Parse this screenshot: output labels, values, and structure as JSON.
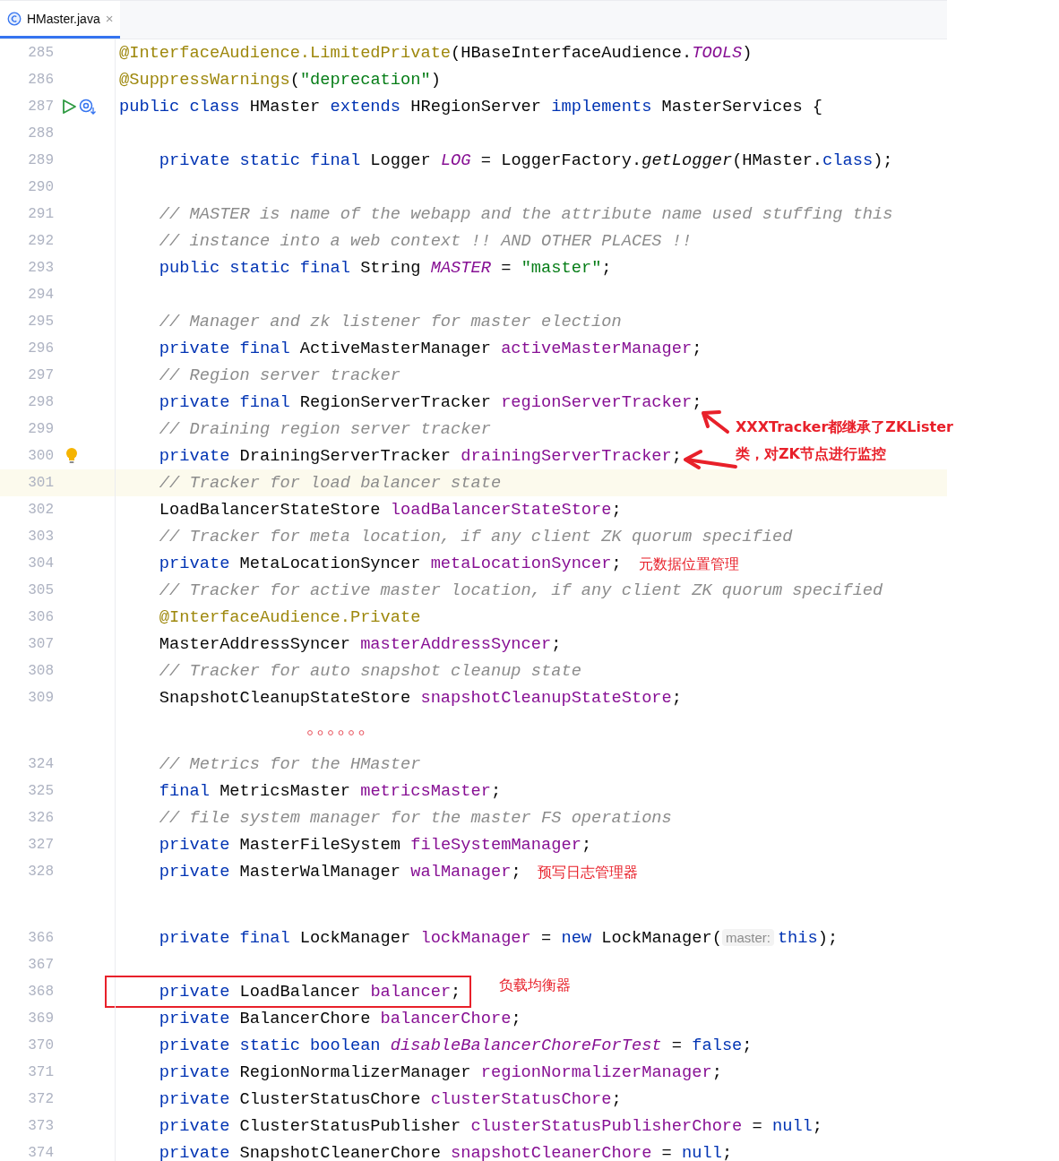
{
  "tabs": [
    {
      "label": "HMaster.java",
      "selected": true,
      "close": "×"
    }
  ],
  "blocks": [
    {
      "lines": [
        {
          "num": "285",
          "tokens": [
            {
              "t": "@InterfaceAudience.LimitedPrivate",
              "kind": "ann"
            },
            {
              "t": "(HBaseInterfaceAudience.",
              "kind": "plain"
            },
            {
              "t": "TOOLS",
              "kind": "sfield"
            },
            {
              "t": ")",
              "kind": "plain"
            }
          ]
        },
        {
          "num": "286",
          "tokens": [
            {
              "t": "@SuppressWarnings",
              "kind": "ann"
            },
            {
              "t": "(",
              "kind": "plain"
            },
            {
              "t": "\"deprecation\"",
              "kind": "string"
            },
            {
              "t": ")",
              "kind": "plain"
            }
          ]
        },
        {
          "num": "287",
          "runnable": true,
          "tokens": [
            {
              "t": "public class ",
              "kind": "kw"
            },
            {
              "t": "HMaster ",
              "kind": "plain"
            },
            {
              "t": "extends ",
              "kind": "kw"
            },
            {
              "t": "HRegionServer ",
              "kind": "plain"
            },
            {
              "t": "implements ",
              "kind": "kw"
            },
            {
              "t": "MasterServices {",
              "kind": "plain"
            }
          ]
        },
        {
          "num": "288"
        },
        {
          "num": "289",
          "tokens": [
            {
              "t": "    private static final ",
              "kind": "kw"
            },
            {
              "t": "Logger ",
              "kind": "plain"
            },
            {
              "t": "LOG",
              "kind": "sfield"
            },
            {
              "t": " = LoggerFactory.",
              "kind": "plain"
            },
            {
              "t": "getLogger",
              "kind": "smethod"
            },
            {
              "t": "(HMaster.",
              "kind": "plain"
            },
            {
              "t": "class",
              "kind": "kw"
            },
            {
              "t": ");",
              "kind": "plain"
            }
          ]
        },
        {
          "num": "290"
        },
        {
          "num": "291",
          "tokens": [
            {
              "t": "    // MASTER is name of the webapp and the attribute name used stuffing this",
              "kind": "comment"
            }
          ]
        },
        {
          "num": "292",
          "tokens": [
            {
              "t": "    // instance into a web context !! AND OTHER PLACES !!",
              "kind": "comment"
            }
          ]
        },
        {
          "num": "293",
          "tokens": [
            {
              "t": "    public static final ",
              "kind": "kw"
            },
            {
              "t": "String ",
              "kind": "plain"
            },
            {
              "t": "MASTER",
              "kind": "sfield"
            },
            {
              "t": " = ",
              "kind": "plain"
            },
            {
              "t": "\"master\"",
              "kind": "string"
            },
            {
              "t": ";",
              "kind": "plain"
            }
          ]
        },
        {
          "num": "294"
        },
        {
          "num": "295",
          "tokens": [
            {
              "t": "    // Manager and zk listener for master election",
              "kind": "comment"
            }
          ]
        },
        {
          "num": "296",
          "tokens": [
            {
              "t": "    private final ",
              "kind": "kw"
            },
            {
              "t": "ActiveMasterManager ",
              "kind": "plain"
            },
            {
              "t": "activeMasterManager",
              "kind": "field"
            },
            {
              "t": ";",
              "kind": "plain"
            }
          ]
        },
        {
          "num": "297",
          "tokens": [
            {
              "t": "    // Region server tracker",
              "kind": "comment"
            }
          ]
        },
        {
          "num": "298",
          "tokens": [
            {
              "t": "    private final ",
              "kind": "kw"
            },
            {
              "t": "RegionServerTracker ",
              "kind": "plain"
            },
            {
              "t": "regionServerTracker",
              "kind": "field"
            },
            {
              "t": ";",
              "kind": "plain"
            }
          ]
        },
        {
          "num": "299",
          "tokens": [
            {
              "t": "    // Draining region server tracker",
              "kind": "comment"
            }
          ]
        },
        {
          "num": "300",
          "intention": true,
          "tokens": [
            {
              "t": "    private ",
              "kind": "kw"
            },
            {
              "t": "DrainingServerTracker ",
              "kind": "plain"
            },
            {
              "t": "drainingServerTracker",
              "kind": "field"
            },
            {
              "t": ";",
              "kind": "plain"
            }
          ]
        },
        {
          "num": "301",
          "current": true,
          "tokens": [
            {
              "t": "    // Tracker for load balancer state",
              "kind": "comment"
            }
          ]
        },
        {
          "num": "302",
          "tokens": [
            {
              "t": "    LoadBalancerStateStore ",
              "kind": "plain"
            },
            {
              "t": "loadBalancerStateStore",
              "kind": "field"
            },
            {
              "t": ";",
              "kind": "plain"
            }
          ]
        },
        {
          "num": "303",
          "tokens": [
            {
              "t": "    // Tracker for meta location, if any client ZK quorum specified",
              "kind": "comment"
            }
          ]
        },
        {
          "num": "304",
          "tokens": [
            {
              "t": "    private ",
              "kind": "kw"
            },
            {
              "t": "MetaLocationSyncer ",
              "kind": "plain"
            },
            {
              "t": "metaLocationSyncer",
              "kind": "field"
            },
            {
              "t": ";",
              "kind": "plain"
            }
          ]
        },
        {
          "num": "305",
          "tokens": [
            {
              "t": "    // Tracker for active master location, if any client ZK quorum specified",
              "kind": "comment"
            }
          ]
        },
        {
          "num": "306",
          "tokens": [
            {
              "t": "    @InterfaceAudience.Private",
              "kind": "ann"
            }
          ]
        },
        {
          "num": "307",
          "tokens": [
            {
              "t": "    MasterAddressSyncer ",
              "kind": "plain"
            },
            {
              "t": "masterAddressSyncer",
              "kind": "field"
            },
            {
              "t": ";",
              "kind": "plain"
            }
          ]
        },
        {
          "num": "308",
          "tokens": [
            {
              "t": "    // Tracker for auto snapshot cleanup state",
              "kind": "comment"
            }
          ]
        },
        {
          "num": "309",
          "tokens": [
            {
              "t": "    SnapshotCleanupStateStore ",
              "kind": "plain"
            },
            {
              "t": "snapshotCleanupStateStore",
              "kind": "field"
            },
            {
              "t": ";",
              "kind": "plain"
            }
          ]
        }
      ]
    },
    {
      "lines": [
        {
          "num": "324",
          "tokens": [
            {
              "t": "    // Metrics for the HMaster",
              "kind": "comment"
            }
          ]
        },
        {
          "num": "325",
          "tokens": [
            {
              "t": "    final ",
              "kind": "kw"
            },
            {
              "t": "MetricsMaster ",
              "kind": "plain"
            },
            {
              "t": "metricsMaster",
              "kind": "field"
            },
            {
              "t": ";",
              "kind": "plain"
            }
          ]
        },
        {
          "num": "326",
          "tokens": [
            {
              "t": "    // file system manager for the master FS operations",
              "kind": "comment"
            }
          ]
        },
        {
          "num": "327",
          "tokens": [
            {
              "t": "    private ",
              "kind": "kw"
            },
            {
              "t": "MasterFileSystem ",
              "kind": "plain"
            },
            {
              "t": "fileSystemManager",
              "kind": "field"
            },
            {
              "t": ";",
              "kind": "plain"
            }
          ]
        },
        {
          "num": "328",
          "tokens": [
            {
              "t": "    private ",
              "kind": "kw"
            },
            {
              "t": "MasterWalManager ",
              "kind": "plain"
            },
            {
              "t": "walManager",
              "kind": "field"
            },
            {
              "t": ";",
              "kind": "plain"
            }
          ]
        }
      ]
    },
    {
      "lines": [
        {
          "num": "366",
          "tokens": [
            {
              "t": "    private final ",
              "kind": "kw"
            },
            {
              "t": "LockManager ",
              "kind": "plain"
            },
            {
              "t": "lockManager",
              "kind": "field"
            },
            {
              "t": " = ",
              "kind": "plain"
            },
            {
              "t": "new ",
              "kind": "kw"
            },
            {
              "t": "LockManager(",
              "kind": "plain"
            },
            {
              "t": "master:",
              "kind": "hint"
            },
            {
              "t": "this",
              "kind": "kw"
            },
            {
              "t": ");",
              "kind": "plain"
            }
          ]
        },
        {
          "num": "367"
        },
        {
          "num": "368",
          "boxed": true,
          "tokens": [
            {
              "t": "    private ",
              "kind": "kw"
            },
            {
              "t": "LoadBalancer ",
              "kind": "plain"
            },
            {
              "t": "balancer",
              "kind": "field"
            },
            {
              "t": ";",
              "kind": "plain"
            }
          ]
        },
        {
          "num": "369",
          "tokens": [
            {
              "t": "    private ",
              "kind": "kw"
            },
            {
              "t": "BalancerChore ",
              "kind": "plain"
            },
            {
              "t": "balancerChore",
              "kind": "field"
            },
            {
              "t": ";",
              "kind": "plain"
            }
          ]
        },
        {
          "num": "370",
          "tokens": [
            {
              "t": "    private static boolean ",
              "kind": "kw"
            },
            {
              "t": "disableBalancerChoreForTest",
              "kind": "sfield"
            },
            {
              "t": " = ",
              "kind": "plain"
            },
            {
              "t": "false",
              "kind": "kw"
            },
            {
              "t": ";",
              "kind": "plain"
            }
          ]
        },
        {
          "num": "371",
          "tokens": [
            {
              "t": "    private ",
              "kind": "kw"
            },
            {
              "t": "RegionNormalizerManager ",
              "kind": "plain"
            },
            {
              "t": "regionNormalizerManager",
              "kind": "field"
            },
            {
              "t": ";",
              "kind": "plain"
            }
          ]
        },
        {
          "num": "372",
          "tokens": [
            {
              "t": "    private ",
              "kind": "kw"
            },
            {
              "t": "ClusterStatusChore ",
              "kind": "plain"
            },
            {
              "t": "clusterStatusChore",
              "kind": "field"
            },
            {
              "t": ";",
              "kind": "plain"
            }
          ]
        },
        {
          "num": "373",
          "tokens": [
            {
              "t": "    private ",
              "kind": "kw"
            },
            {
              "t": "ClusterStatusPublisher ",
              "kind": "plain"
            },
            {
              "t": "clusterStatusPublisherChore",
              "kind": "field"
            },
            {
              "t": " = ",
              "kind": "plain"
            },
            {
              "t": "null",
              "kind": "kw"
            },
            {
              "t": ";",
              "kind": "plain"
            }
          ]
        },
        {
          "num": "374",
          "tokens": [
            {
              "t": "    private ",
              "kind": "kw"
            },
            {
              "t": "SnapshotCleanerChore ",
              "kind": "plain"
            },
            {
              "t": "snapshotCleanerChore",
              "kind": "field"
            },
            {
              "t": " = ",
              "kind": "plain"
            },
            {
              "t": "null",
              "kind": "kw"
            },
            {
              "t": ";",
              "kind": "plain"
            }
          ]
        }
      ]
    }
  ],
  "notes": [
    {
      "kind": "callout",
      "lines": [
        "XXXTracker都继承了ZKLister",
        "类，对ZK节点进行监控"
      ]
    },
    {
      "kind": "label",
      "lines": [
        "元数据位置管理"
      ]
    },
    {
      "kind": "label",
      "lines": [
        "预写日志管理器"
      ]
    },
    {
      "kind": "label",
      "lines": [
        "负载均衡器"
      ]
    }
  ]
}
